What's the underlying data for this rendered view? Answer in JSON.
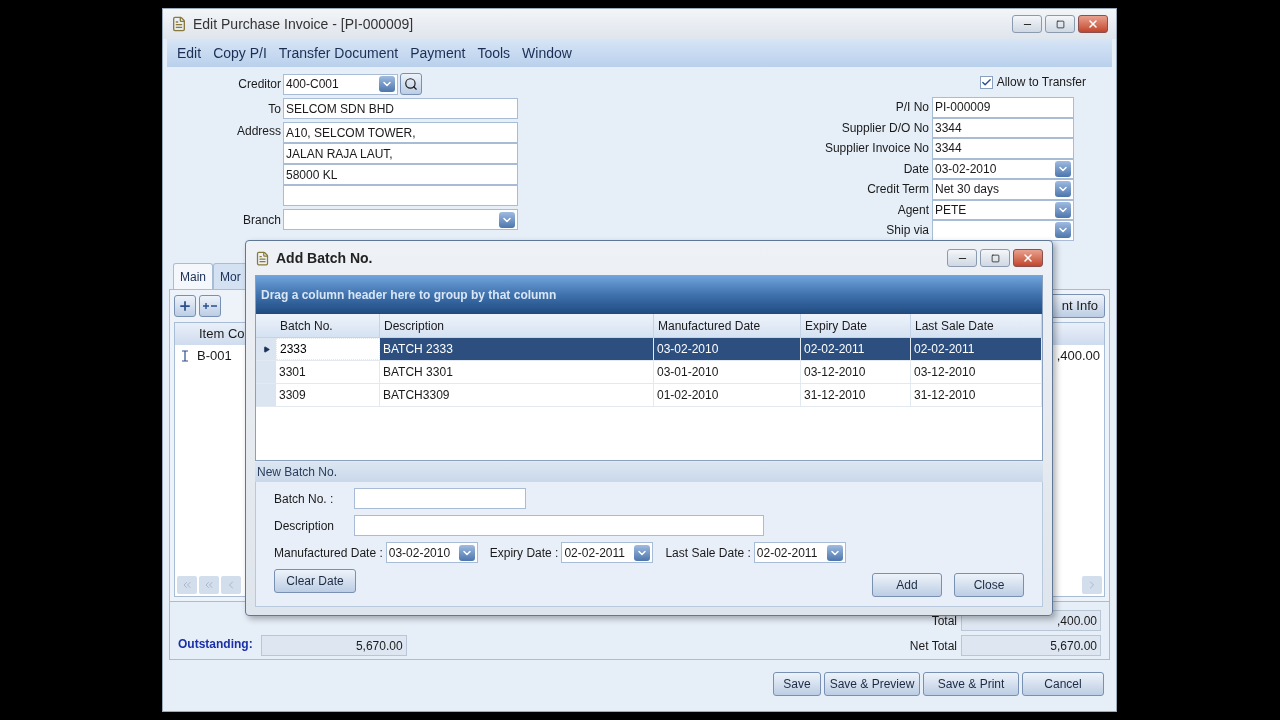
{
  "window": {
    "title": "Edit Purchase Invoice - [PI-000009]"
  },
  "menu": [
    "Edit",
    "Copy P/I",
    "Transfer Document",
    "Payment",
    "Tools",
    "Window"
  ],
  "creditor": {
    "label": "Creditor",
    "value": "400-C001"
  },
  "to": {
    "label": "To",
    "value": "SELCOM SDN BHD"
  },
  "address": {
    "label": "Address",
    "lines": [
      "A10, SELCOM TOWER,",
      "JALAN RAJA LAUT,",
      "58000 KL"
    ]
  },
  "branch": {
    "label": "Branch"
  },
  "allow_transfer": {
    "label": "Allow to Transfer",
    "checked": true
  },
  "fields": [
    {
      "label": "P/I No",
      "value": "PI-000009",
      "kind": "text"
    },
    {
      "label": "Supplier D/O No",
      "value": "3344",
      "kind": "text"
    },
    {
      "label": "Supplier Invoice No",
      "value": "3344",
      "kind": "text"
    },
    {
      "label": "Date",
      "value": "03-02-2010",
      "kind": "dropdown"
    },
    {
      "label": "Credit Term",
      "value": "Net 30 days",
      "kind": "dropdown"
    },
    {
      "label": "Agent",
      "value": "PETE",
      "kind": "dropdown"
    },
    {
      "label": "Ship via",
      "kind": "dropdown"
    }
  ],
  "tabs": [
    {
      "label": "Main",
      "selected": true
    },
    {
      "label": "Mor",
      "selected": false
    }
  ],
  "info_button": "nt Info",
  "item_grid": {
    "column_1": "Item Co",
    "row_code": "B-001",
    "row_amount": ",400.00"
  },
  "outstanding": {
    "label": "Outstanding:",
    "value": "5,670.00"
  },
  "totals": [
    {
      "label": "Total",
      "value": ",400.00"
    },
    {
      "label": "Net Total",
      "value": "5,670.00"
    }
  ],
  "buttons": [
    "Save",
    "Save & Preview",
    "Save & Print",
    "Cancel"
  ],
  "dialog": {
    "title": "Add Batch No.",
    "group_hint": "Drag a column header here to group by that column",
    "columns": [
      "Batch No.",
      "Description",
      "Manufactured Date",
      "Expiry Date",
      "Last Sale Date"
    ],
    "rows": [
      {
        "cells": [
          "2333",
          "BATCH 2333",
          "03-02-2010",
          "02-02-2011",
          "02-02-2011"
        ],
        "selected": true
      },
      {
        "cells": [
          "3301",
          "BATCH 3301",
          "03-01-2010",
          "03-12-2010",
          "03-12-2010"
        ],
        "selected": false
      },
      {
        "cells": [
          "3309",
          "BATCH3309",
          "01-02-2010",
          "31-12-2010",
          "31-12-2010"
        ],
        "selected": false
      }
    ],
    "section": "New Batch No.",
    "batch_no_label": "Batch No. :",
    "description_label": "Description",
    "dates": [
      {
        "label": "Manufactured Date :",
        "value": "03-02-2010"
      },
      {
        "label": "Expiry Date :",
        "value": "02-02-2011"
      },
      {
        "label": "Last Sale Date :",
        "value": "02-02-2011"
      }
    ],
    "clear_button": "Clear Date",
    "add_button": "Add",
    "close_button": "Close"
  }
}
